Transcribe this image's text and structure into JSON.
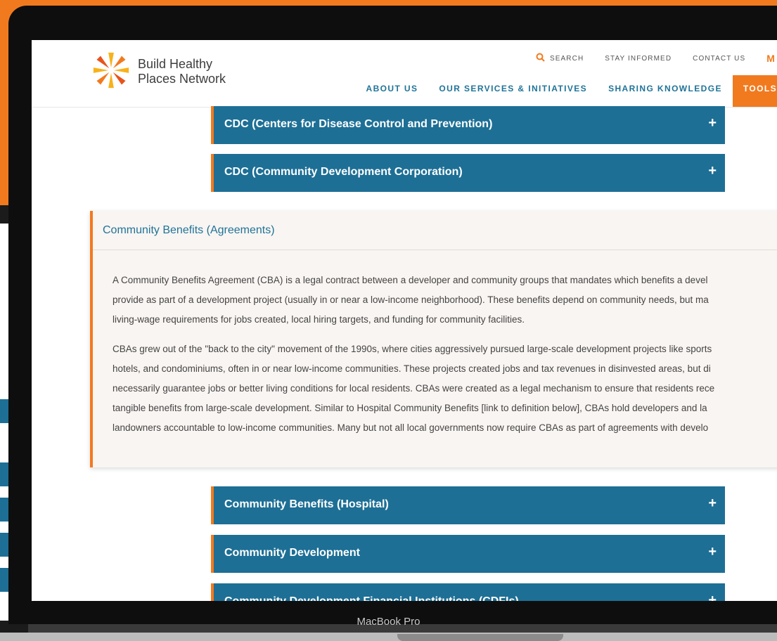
{
  "device_label": "MacBook Pro",
  "brand": {
    "line1": "Build Healthy",
    "line2": "Places Network",
    "accent": "#f27a1e",
    "primary": "#1d6f95"
  },
  "utility_nav": {
    "search": "SEARCH",
    "stay_informed": "STAY INFORMED",
    "contact": "CONTACT US",
    "more": "M"
  },
  "main_nav": [
    "ABOUT US",
    "OUR SERVICES & INITIATIVES",
    "SHARING KNOWLEDGE",
    "TOOLS"
  ],
  "accordion_top": [
    "CDC (Centers for Disease Control and Prevention)",
    "CDC (Community Development Corporation)"
  ],
  "expanded": {
    "title": "Community Benefits (Agreements)",
    "p1_lines": [
      "A Community Benefits Agreement (CBA) is a legal contract between a developer and community groups that mandates which benefits a devel",
      "provide as part of a development project (usually in or near a low-income neighborhood). These benefits depend on community needs, but ma",
      "living-wage requirements for jobs created, local hiring targets, and funding for community facilities."
    ],
    "p2_lines": [
      "CBAs grew out of the \"back to the city\" movement of the 1990s, where cities aggressively pursued large-scale development projects like sports",
      "hotels, and condominiums, often in or near low-income communities. These projects created jobs and tax revenues in disinvested areas, but di",
      "necessarily guarantee jobs or better living conditions for local residents. CBAs were created as a legal mechanism to ensure that residents rece",
      "tangible benefits from large-scale development. Similar to Hospital Community Benefits [link to definition below], CBAs hold developers and la",
      "landowners accountable to low-income communities. Many but not all local governments now require CBAs as part of agreements with develo"
    ]
  },
  "accordion_bottom": [
    "Community Benefits (Hospital)",
    "Community Development",
    "Community Development Financial Institutions (CDFIs)"
  ],
  "plus_symbol": "+",
  "icons": {
    "search": "search-icon",
    "logo": "sunburst-logo-icon",
    "expand": "plus-icon"
  }
}
